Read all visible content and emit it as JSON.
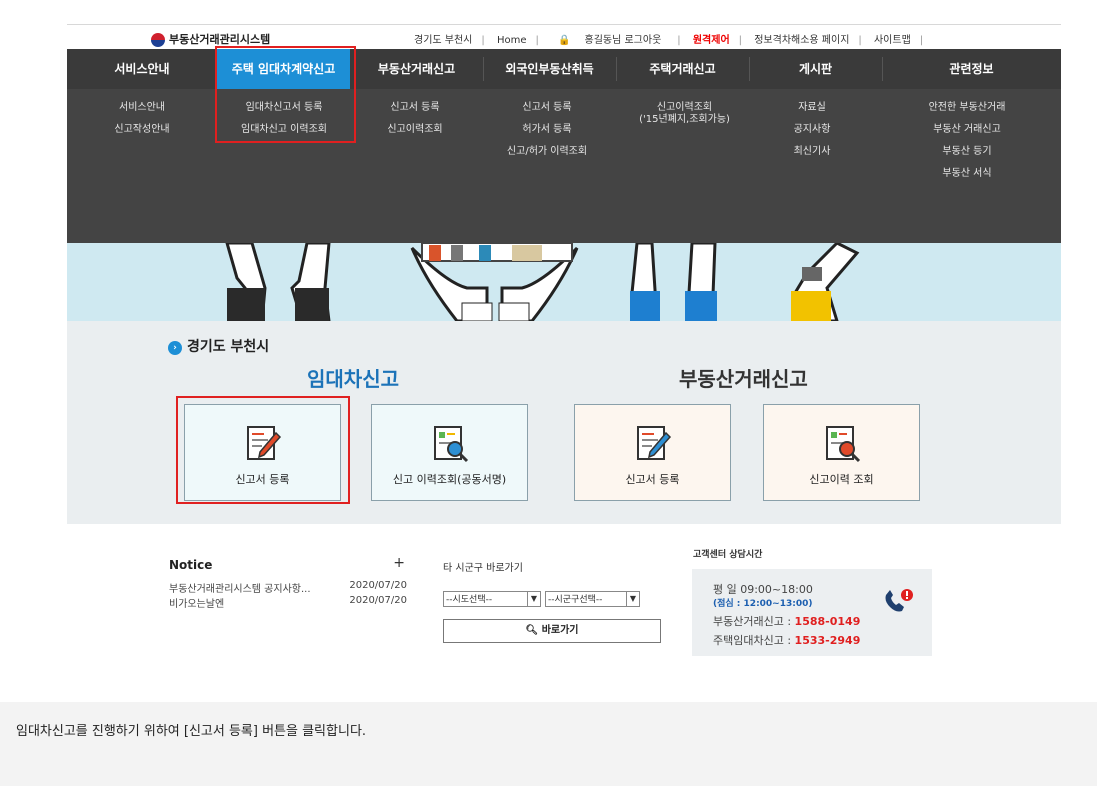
{
  "topbar": {
    "logo": "부동산거래관리시스템",
    "links": [
      "경기도 부천시",
      "Home",
      "홍길동님 로그아웃",
      "원격제어",
      "정보격차해소용 페이지",
      "사이트맵"
    ]
  },
  "nav": {
    "menus": [
      "서비스안내",
      "주택 임대차계약신고",
      "부동산거래신고",
      "외국인부동산취득",
      "주택거래신고",
      "게시판",
      "관련정보"
    ],
    "submenus": [
      [
        "서비스안내",
        "신고작성안내"
      ],
      [
        "임대차신고서 등록",
        "임대차신고 이력조회"
      ],
      [
        "신고서 등록",
        "신고이력조회"
      ],
      [
        "신고서 등록",
        "허가서 등록",
        "신고/허가 이력조회"
      ],
      [
        "신고이력조회",
        "('15년폐지,조회가능)"
      ],
      [
        "자료실",
        "공지사항",
        "최신기사"
      ],
      [
        "안전한 부동산거래",
        "부동산 거래신고",
        "부동산 등기",
        "부동산 서식"
      ]
    ]
  },
  "main": {
    "region": "경기도 부천시",
    "lease_heading": "임대차신고",
    "trade_heading": "부동산거래신고",
    "cards": [
      "신고서 등록",
      "신고 이력조회(공동서명)",
      "신고서 등록",
      "신고이력 조회"
    ]
  },
  "notice": {
    "title": "Notice",
    "plus": "+",
    "items": [
      {
        "text": "부동산거래관리시스템 공지사항...",
        "date": "2020/07/20"
      },
      {
        "text": "비가오는날엔",
        "date": "2020/07/20"
      }
    ]
  },
  "quick": {
    "title": "타 시군구 바로가기",
    "sido": "--시도선택--",
    "sigungu": "--시군구선택--",
    "go": "바로가기"
  },
  "cs": {
    "title": "고객센터 상담시간",
    "weekday": "평 일 09:00~18:00",
    "lunch": "(점심 : 12:00~13:00)",
    "trade_label": "부동산거래신고 :",
    "trade_phone": "1588-0149",
    "lease_label": "주택임대차신고 :",
    "lease_phone": "1533-2949"
  },
  "instruction": "임대차신고를 진행하기 위하여 [신고서 등록] 버튼을 클릭합니다.",
  "colors": {
    "accent": "#1d8fd6",
    "highlight": "#e02020",
    "nav_bg": "#3a3a3a"
  }
}
